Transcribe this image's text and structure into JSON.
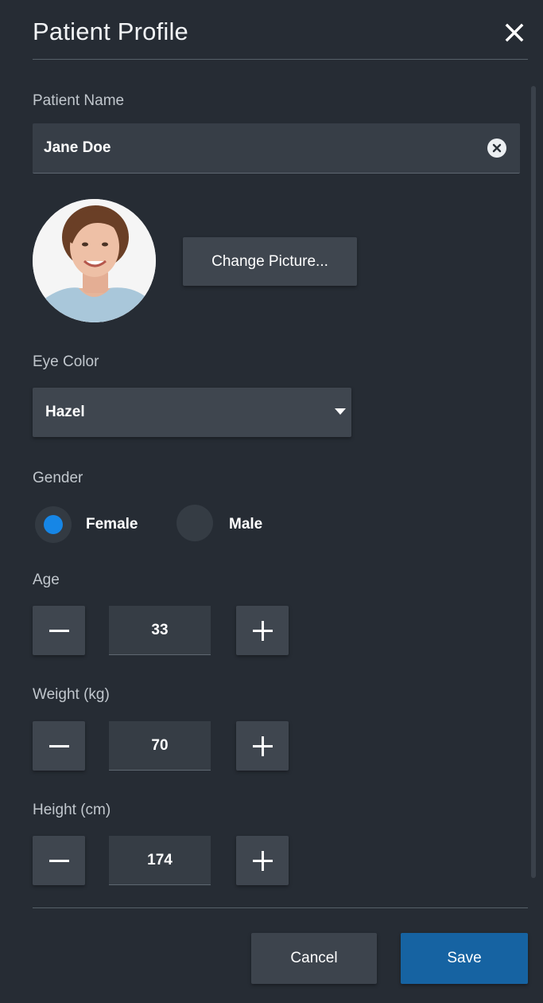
{
  "header": {
    "title": "Patient Profile",
    "close_icon": "close-icon"
  },
  "patient_name": {
    "label": "Patient Name",
    "value": "Jane Doe",
    "clear_icon": "clear-icon"
  },
  "picture": {
    "change_label": "Change Picture..."
  },
  "eye_color": {
    "label": "Eye Color",
    "selected": "Hazel",
    "dropdown_icon": "caret-down-icon"
  },
  "gender": {
    "label": "Gender",
    "options": [
      {
        "label": "Female",
        "selected": true
      },
      {
        "label": "Male",
        "selected": false
      }
    ]
  },
  "age": {
    "label": "Age",
    "value": "33"
  },
  "weight": {
    "label": "Weight (kg)",
    "value": "70"
  },
  "height": {
    "label": "Height (cm)",
    "value": "174"
  },
  "footer": {
    "cancel_label": "Cancel",
    "save_label": "Save"
  },
  "colors": {
    "background": "#262c34",
    "accent": "#1686e6",
    "save_button": "#1663a2"
  }
}
